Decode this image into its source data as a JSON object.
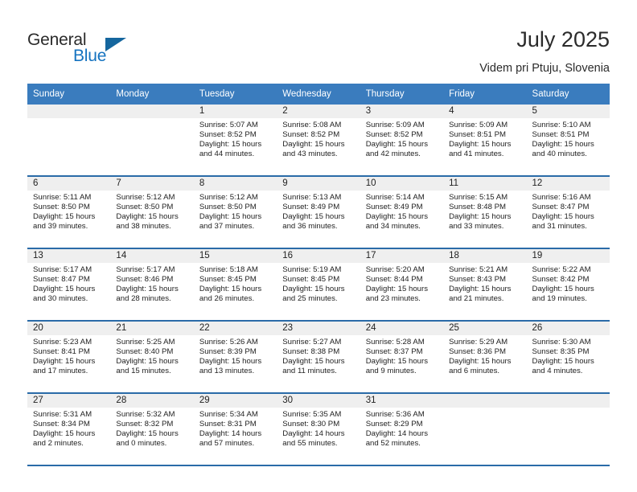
{
  "brand": {
    "name_part1": "General",
    "name_part2": "Blue",
    "logo_icon": "triangle-logo-icon",
    "accent_color": "#1573c0"
  },
  "header": {
    "title": "July 2025",
    "subtitle": "Videm pri Ptuju, Slovenia"
  },
  "colors": {
    "header_bar": "#3a7cbe",
    "row_divider": "#2a6ba8",
    "day_number_band": "#efefef"
  },
  "calendar": {
    "weekday_headers": [
      "Sunday",
      "Monday",
      "Tuesday",
      "Wednesday",
      "Thursday",
      "Friday",
      "Saturday"
    ],
    "weeks": [
      [
        {
          "day": "",
          "sunrise": "",
          "sunset": "",
          "daylight_line1": "",
          "daylight_line2": ""
        },
        {
          "day": "",
          "sunrise": "",
          "sunset": "",
          "daylight_line1": "",
          "daylight_line2": ""
        },
        {
          "day": "1",
          "sunrise": "Sunrise: 5:07 AM",
          "sunset": "Sunset: 8:52 PM",
          "daylight_line1": "Daylight: 15 hours",
          "daylight_line2": "and 44 minutes."
        },
        {
          "day": "2",
          "sunrise": "Sunrise: 5:08 AM",
          "sunset": "Sunset: 8:52 PM",
          "daylight_line1": "Daylight: 15 hours",
          "daylight_line2": "and 43 minutes."
        },
        {
          "day": "3",
          "sunrise": "Sunrise: 5:09 AM",
          "sunset": "Sunset: 8:52 PM",
          "daylight_line1": "Daylight: 15 hours",
          "daylight_line2": "and 42 minutes."
        },
        {
          "day": "4",
          "sunrise": "Sunrise: 5:09 AM",
          "sunset": "Sunset: 8:51 PM",
          "daylight_line1": "Daylight: 15 hours",
          "daylight_line2": "and 41 minutes."
        },
        {
          "day": "5",
          "sunrise": "Sunrise: 5:10 AM",
          "sunset": "Sunset: 8:51 PM",
          "daylight_line1": "Daylight: 15 hours",
          "daylight_line2": "and 40 minutes."
        }
      ],
      [
        {
          "day": "6",
          "sunrise": "Sunrise: 5:11 AM",
          "sunset": "Sunset: 8:50 PM",
          "daylight_line1": "Daylight: 15 hours",
          "daylight_line2": "and 39 minutes."
        },
        {
          "day": "7",
          "sunrise": "Sunrise: 5:12 AM",
          "sunset": "Sunset: 8:50 PM",
          "daylight_line1": "Daylight: 15 hours",
          "daylight_line2": "and 38 minutes."
        },
        {
          "day": "8",
          "sunrise": "Sunrise: 5:12 AM",
          "sunset": "Sunset: 8:50 PM",
          "daylight_line1": "Daylight: 15 hours",
          "daylight_line2": "and 37 minutes."
        },
        {
          "day": "9",
          "sunrise": "Sunrise: 5:13 AM",
          "sunset": "Sunset: 8:49 PM",
          "daylight_line1": "Daylight: 15 hours",
          "daylight_line2": "and 36 minutes."
        },
        {
          "day": "10",
          "sunrise": "Sunrise: 5:14 AM",
          "sunset": "Sunset: 8:49 PM",
          "daylight_line1": "Daylight: 15 hours",
          "daylight_line2": "and 34 minutes."
        },
        {
          "day": "11",
          "sunrise": "Sunrise: 5:15 AM",
          "sunset": "Sunset: 8:48 PM",
          "daylight_line1": "Daylight: 15 hours",
          "daylight_line2": "and 33 minutes."
        },
        {
          "day": "12",
          "sunrise": "Sunrise: 5:16 AM",
          "sunset": "Sunset: 8:47 PM",
          "daylight_line1": "Daylight: 15 hours",
          "daylight_line2": "and 31 minutes."
        }
      ],
      [
        {
          "day": "13",
          "sunrise": "Sunrise: 5:17 AM",
          "sunset": "Sunset: 8:47 PM",
          "daylight_line1": "Daylight: 15 hours",
          "daylight_line2": "and 30 minutes."
        },
        {
          "day": "14",
          "sunrise": "Sunrise: 5:17 AM",
          "sunset": "Sunset: 8:46 PM",
          "daylight_line1": "Daylight: 15 hours",
          "daylight_line2": "and 28 minutes."
        },
        {
          "day": "15",
          "sunrise": "Sunrise: 5:18 AM",
          "sunset": "Sunset: 8:45 PM",
          "daylight_line1": "Daylight: 15 hours",
          "daylight_line2": "and 26 minutes."
        },
        {
          "day": "16",
          "sunrise": "Sunrise: 5:19 AM",
          "sunset": "Sunset: 8:45 PM",
          "daylight_line1": "Daylight: 15 hours",
          "daylight_line2": "and 25 minutes."
        },
        {
          "day": "17",
          "sunrise": "Sunrise: 5:20 AM",
          "sunset": "Sunset: 8:44 PM",
          "daylight_line1": "Daylight: 15 hours",
          "daylight_line2": "and 23 minutes."
        },
        {
          "day": "18",
          "sunrise": "Sunrise: 5:21 AM",
          "sunset": "Sunset: 8:43 PM",
          "daylight_line1": "Daylight: 15 hours",
          "daylight_line2": "and 21 minutes."
        },
        {
          "day": "19",
          "sunrise": "Sunrise: 5:22 AM",
          "sunset": "Sunset: 8:42 PM",
          "daylight_line1": "Daylight: 15 hours",
          "daylight_line2": "and 19 minutes."
        }
      ],
      [
        {
          "day": "20",
          "sunrise": "Sunrise: 5:23 AM",
          "sunset": "Sunset: 8:41 PM",
          "daylight_line1": "Daylight: 15 hours",
          "daylight_line2": "and 17 minutes."
        },
        {
          "day": "21",
          "sunrise": "Sunrise: 5:25 AM",
          "sunset": "Sunset: 8:40 PM",
          "daylight_line1": "Daylight: 15 hours",
          "daylight_line2": "and 15 minutes."
        },
        {
          "day": "22",
          "sunrise": "Sunrise: 5:26 AM",
          "sunset": "Sunset: 8:39 PM",
          "daylight_line1": "Daylight: 15 hours",
          "daylight_line2": "and 13 minutes."
        },
        {
          "day": "23",
          "sunrise": "Sunrise: 5:27 AM",
          "sunset": "Sunset: 8:38 PM",
          "daylight_line1": "Daylight: 15 hours",
          "daylight_line2": "and 11 minutes."
        },
        {
          "day": "24",
          "sunrise": "Sunrise: 5:28 AM",
          "sunset": "Sunset: 8:37 PM",
          "daylight_line1": "Daylight: 15 hours",
          "daylight_line2": "and 9 minutes."
        },
        {
          "day": "25",
          "sunrise": "Sunrise: 5:29 AM",
          "sunset": "Sunset: 8:36 PM",
          "daylight_line1": "Daylight: 15 hours",
          "daylight_line2": "and 6 minutes."
        },
        {
          "day": "26",
          "sunrise": "Sunrise: 5:30 AM",
          "sunset": "Sunset: 8:35 PM",
          "daylight_line1": "Daylight: 15 hours",
          "daylight_line2": "and 4 minutes."
        }
      ],
      [
        {
          "day": "27",
          "sunrise": "Sunrise: 5:31 AM",
          "sunset": "Sunset: 8:34 PM",
          "daylight_line1": "Daylight: 15 hours",
          "daylight_line2": "and 2 minutes."
        },
        {
          "day": "28",
          "sunrise": "Sunrise: 5:32 AM",
          "sunset": "Sunset: 8:32 PM",
          "daylight_line1": "Daylight: 15 hours",
          "daylight_line2": "and 0 minutes."
        },
        {
          "day": "29",
          "sunrise": "Sunrise: 5:34 AM",
          "sunset": "Sunset: 8:31 PM",
          "daylight_line1": "Daylight: 14 hours",
          "daylight_line2": "and 57 minutes."
        },
        {
          "day": "30",
          "sunrise": "Sunrise: 5:35 AM",
          "sunset": "Sunset: 8:30 PM",
          "daylight_line1": "Daylight: 14 hours",
          "daylight_line2": "and 55 minutes."
        },
        {
          "day": "31",
          "sunrise": "Sunrise: 5:36 AM",
          "sunset": "Sunset: 8:29 PM",
          "daylight_line1": "Daylight: 14 hours",
          "daylight_line2": "and 52 minutes."
        },
        {
          "day": "",
          "sunrise": "",
          "sunset": "",
          "daylight_line1": "",
          "daylight_line2": ""
        },
        {
          "day": "",
          "sunrise": "",
          "sunset": "",
          "daylight_line1": "",
          "daylight_line2": ""
        }
      ]
    ]
  }
}
